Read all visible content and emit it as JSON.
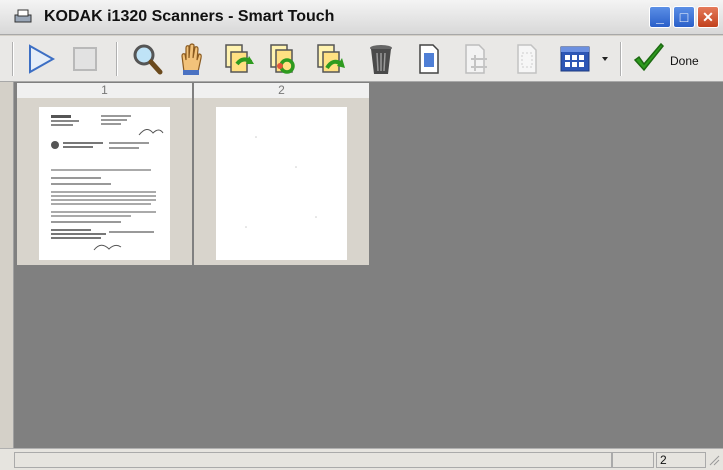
{
  "window": {
    "title": "KODAK i1320 Scanners - Smart Touch",
    "minimize": "_",
    "maximize": "□",
    "close": "✕"
  },
  "toolbar": {
    "buttons": [
      {
        "name": "start-icon",
        "enabled": true
      },
      {
        "name": "stop-icon",
        "enabled": false
      },
      {
        "name": "zoom-icon",
        "enabled": true
      },
      {
        "name": "pan-hand-icon",
        "enabled": true
      },
      {
        "name": "rotate-left-icon",
        "enabled": true
      },
      {
        "name": "rotate-180-icon",
        "enabled": true
      },
      {
        "name": "rotate-right-icon",
        "enabled": true
      },
      {
        "name": "delete-icon",
        "enabled": true
      },
      {
        "name": "page-icon",
        "enabled": true
      },
      {
        "name": "crop-icon",
        "enabled": false
      },
      {
        "name": "page-outline-icon",
        "enabled": false
      },
      {
        "name": "layout-icon",
        "enabled": true
      },
      {
        "name": "done-icon",
        "enabled": true
      }
    ],
    "done_label": "Done"
  },
  "thumbnails": [
    {
      "number": "1"
    },
    {
      "number": "2"
    }
  ],
  "status": {
    "left": "",
    "page_count": "2"
  },
  "colors": {
    "title_blue": "#2a5fc9",
    "workspace": "#808080",
    "done_green": "#2e9b1f"
  }
}
